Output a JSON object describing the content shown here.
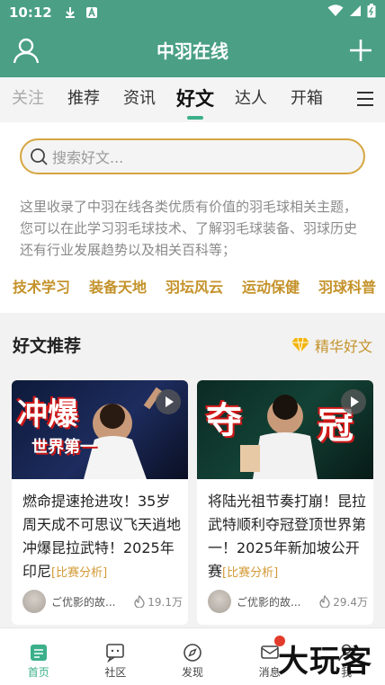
{
  "status": {
    "time": "10:12"
  },
  "app": {
    "title": "中羽在线"
  },
  "tabs": [
    {
      "label": "关注"
    },
    {
      "label": "推荐"
    },
    {
      "label": "资讯"
    },
    {
      "label": "好文"
    },
    {
      "label": "达人"
    },
    {
      "label": "开箱"
    }
  ],
  "search": {
    "placeholder": "搜索好文..."
  },
  "intro": {
    "text": "这里收录了中羽在线各类优质有价值的羽毛球相关主题，您可以在此学习羽毛球技术、了解羽毛球装备、羽球历史还有行业发展趋势以及相关百科等；"
  },
  "categories": [
    "技术学习",
    "装备天地",
    "羽坛风云",
    "运动保健",
    "羽球科普"
  ],
  "recommend": {
    "heading": "好文推荐",
    "more": "精华好文",
    "articles": [
      {
        "thumb_big": "冲爆",
        "thumb_sub": "世界第一",
        "title": "燃命提速抢进攻！35岁周天成不可思议飞天逍地冲爆昆拉武特！2025年印尼",
        "tag": "[比赛分析]",
        "author": "ご优影的故...",
        "views": "19.1万"
      },
      {
        "thumb_big": "夺",
        "thumb_big2": "冠",
        "title": "将陆光祖节奏打崩！昆拉武特顺利夺冠登顶世界第一！2025年新加坡公开赛",
        "tag": "[比赛分析]",
        "author": "ご优影的故...",
        "views": "29.4万"
      }
    ]
  },
  "bottom_nav": [
    {
      "label": "首页"
    },
    {
      "label": "社区"
    },
    {
      "label": "发现"
    },
    {
      "label": "消息"
    },
    {
      "label": "我"
    }
  ],
  "watermark": "大玩客",
  "colors": {
    "primary": "#4a9f84",
    "accent_gold": "#c4922a",
    "tab_indicator": "#3bb08a"
  }
}
